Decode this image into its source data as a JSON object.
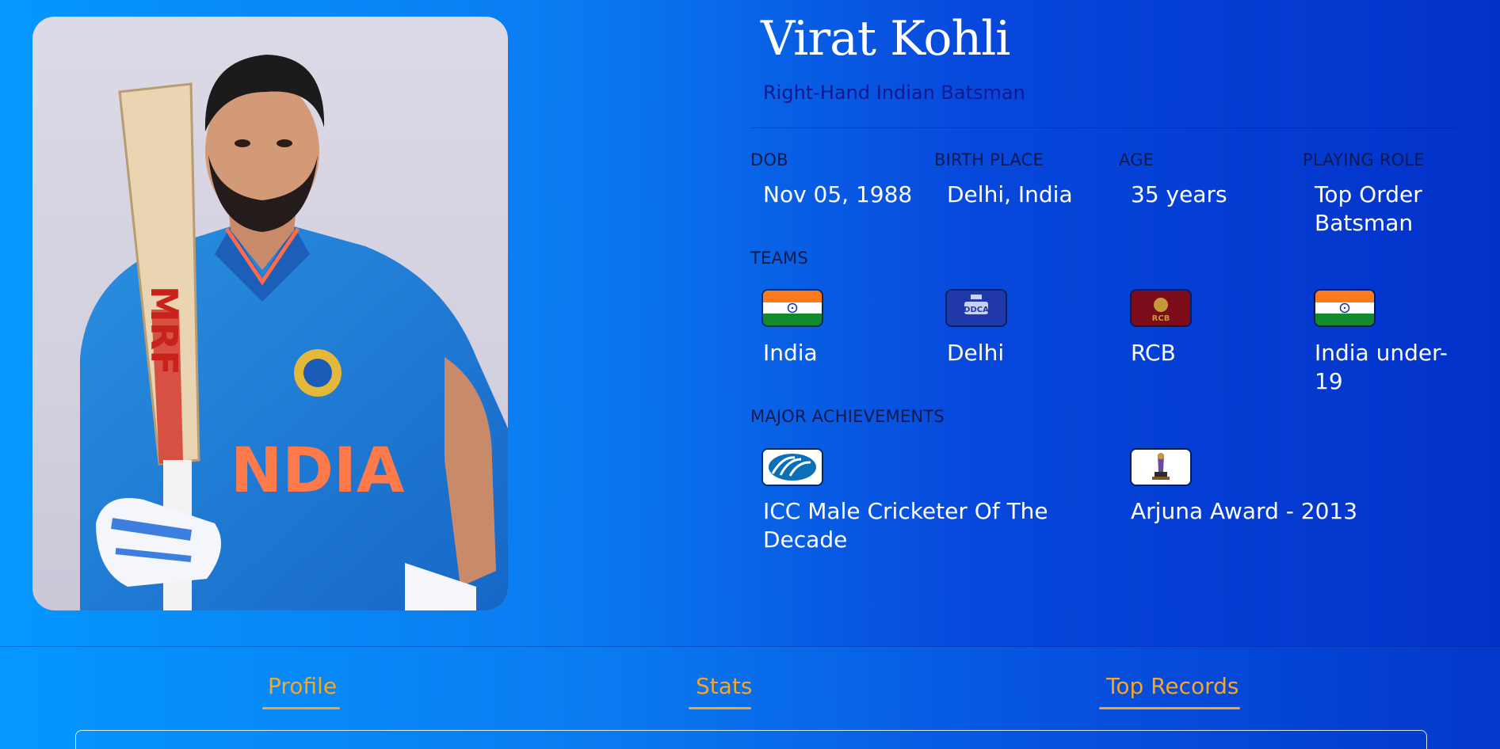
{
  "player": {
    "name": "Virat Kohli",
    "subtitle": "Right-Hand Indian Batsman"
  },
  "info": [
    {
      "label": "DOB",
      "value": "Nov 05, 1988"
    },
    {
      "label": "BIRTH PLACE",
      "value": "Delhi, India"
    },
    {
      "label": "AGE",
      "value": "35 years"
    },
    {
      "label": "PLAYING ROLE",
      "value": "Top Order Batsman"
    }
  ],
  "teams": {
    "heading": "TEAMS",
    "items": [
      {
        "name": "India",
        "icon": "india-flag-icon"
      },
      {
        "name": "Delhi",
        "icon": "delhi-team-logo-icon"
      },
      {
        "name": "RCB",
        "icon": "rcb-logo-icon"
      },
      {
        "name": "India under-19",
        "icon": "india-flag-icon"
      }
    ]
  },
  "achievements": {
    "heading": "MAJOR ACHIEVEMENTS",
    "items": [
      {
        "name": "ICC Male Cricketer Of The Decade",
        "icon": "icc-logo-icon"
      },
      {
        "name": "Arjuna Award - 2013",
        "icon": "arjuna-award-trophy-icon"
      }
    ]
  },
  "tabs": [
    {
      "label": "Profile"
    },
    {
      "label": "Stats"
    },
    {
      "label": "Top Records"
    }
  ],
  "colors": {
    "accent": "#f6a623",
    "subtitle": "#12198a",
    "label": "#0c1a4d",
    "background_start": "#0597ff",
    "background_end": "#0231c9"
  }
}
